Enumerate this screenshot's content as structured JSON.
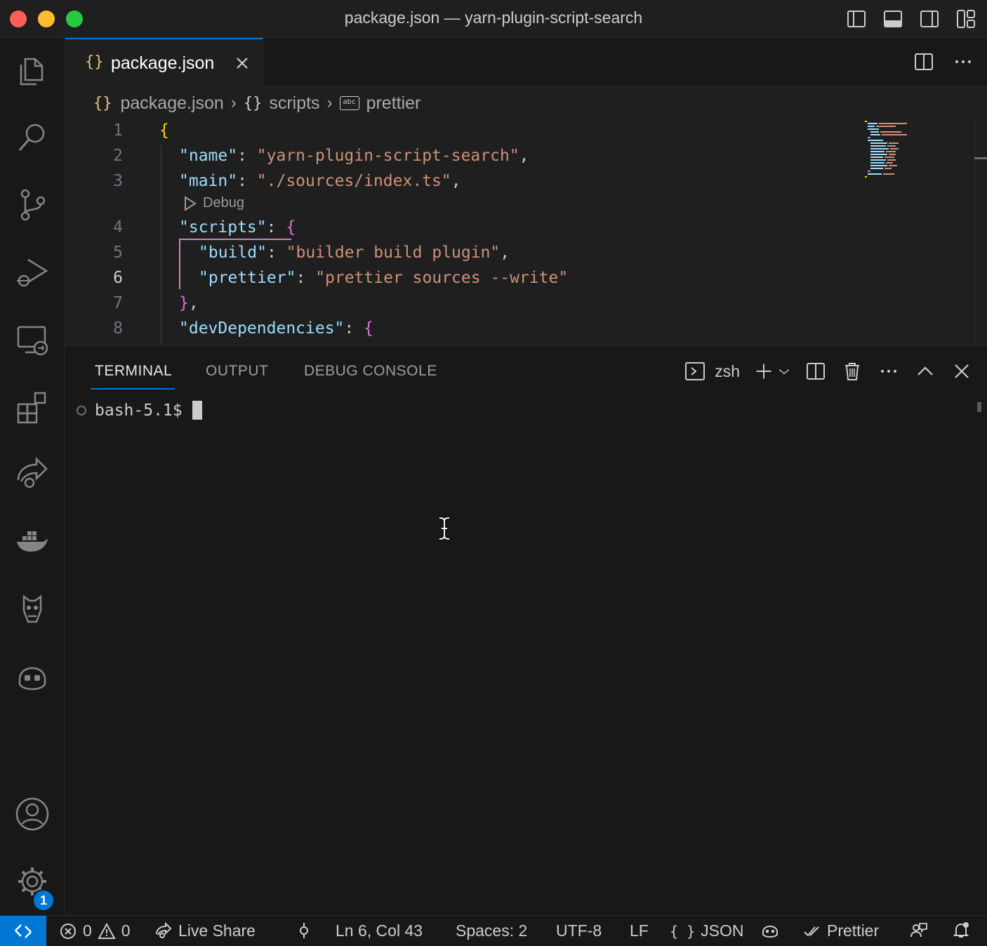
{
  "window": {
    "title": "package.json — yarn-plugin-script-search"
  },
  "tabs": [
    {
      "icon": "{}",
      "label": "package.json"
    }
  ],
  "breadcrumb": {
    "file": "package.json",
    "section": "scripts",
    "key": "prettier",
    "abc": "abc"
  },
  "editor": {
    "codelens": "Debug",
    "lines": [
      {
        "number": "1"
      },
      {
        "number": "2",
        "key": "\"name\"",
        "value": "\"yarn-plugin-script-search\""
      },
      {
        "number": "3",
        "key": "\"main\"",
        "value": "\"./sources/index.ts\""
      },
      {
        "number": "4",
        "key": "\"scripts\""
      },
      {
        "number": "5",
        "key": "\"build\"",
        "value": "\"builder build plugin\""
      },
      {
        "number": "6",
        "key": "\"prettier\"",
        "value": "\"prettier sources --write\""
      },
      {
        "number": "7"
      },
      {
        "number": "8",
        "key": "\"devDependencies\""
      }
    ]
  },
  "panel": {
    "tabs": [
      "TERMINAL",
      "OUTPUT",
      "DEBUG CONSOLE"
    ],
    "active_tab": "TERMINAL",
    "terminal_name": "zsh",
    "prompt": "bash-5.1$"
  },
  "activity_badge": "1",
  "statusbar": {
    "errors": "0",
    "warnings": "0",
    "live_share": "Live Share",
    "position": "Ln 6, Col 43",
    "spaces": "Spaces: 2",
    "encoding": "UTF-8",
    "eol": "LF",
    "language": "JSON",
    "language_icon": "{ }",
    "formatter": "Prettier"
  },
  "colors": {
    "accent": "#0078d4",
    "string": "#ce9178",
    "key": "#9cdcfe",
    "bracket_level1": "#ffd700",
    "bracket_level2": "#da70d6"
  }
}
